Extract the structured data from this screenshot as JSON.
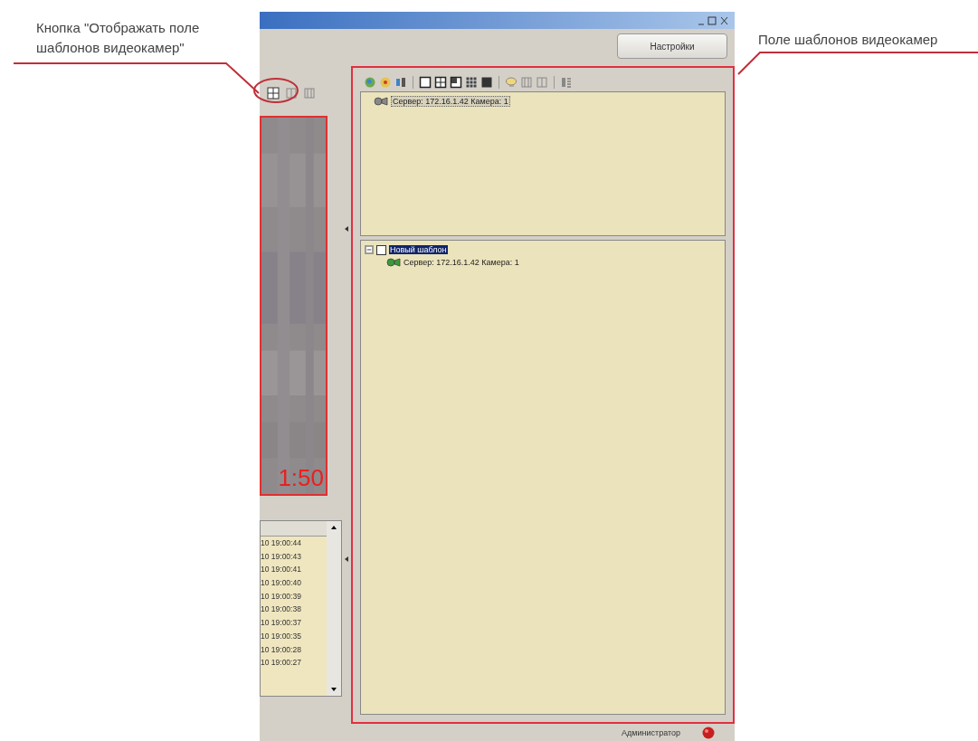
{
  "annotations": [
    {
      "text": "Кнопка \"Отображать поле шаблонов видеокамер\""
    },
    {
      "text": "Поле шаблонов видеокамер"
    }
  ],
  "window": {
    "settings_button": "Настройки"
  },
  "video": {
    "timestamp": "1:50"
  },
  "event_log": {
    "times": [
      "10 19:00:44",
      "10 19:00:43",
      "10 19:00:41",
      "10 19:00:40",
      "10 19:00:39",
      "10 19:00:38",
      "10 19:00:37",
      "10 19:00:35",
      "10 19:00:28",
      "10 19:00:27"
    ]
  },
  "templates": {
    "cameras": [
      {
        "label": "Сервер: 172.16.1.42 Камера: 1"
      }
    ],
    "tree": [
      {
        "label": "Новый шаблон",
        "selected": true,
        "checked": false,
        "expanded": true,
        "children": [
          {
            "label": "Сервер: 172.16.1.42 Камера: 1"
          }
        ]
      }
    ]
  },
  "status_bar": {
    "user": "Администратор"
  }
}
